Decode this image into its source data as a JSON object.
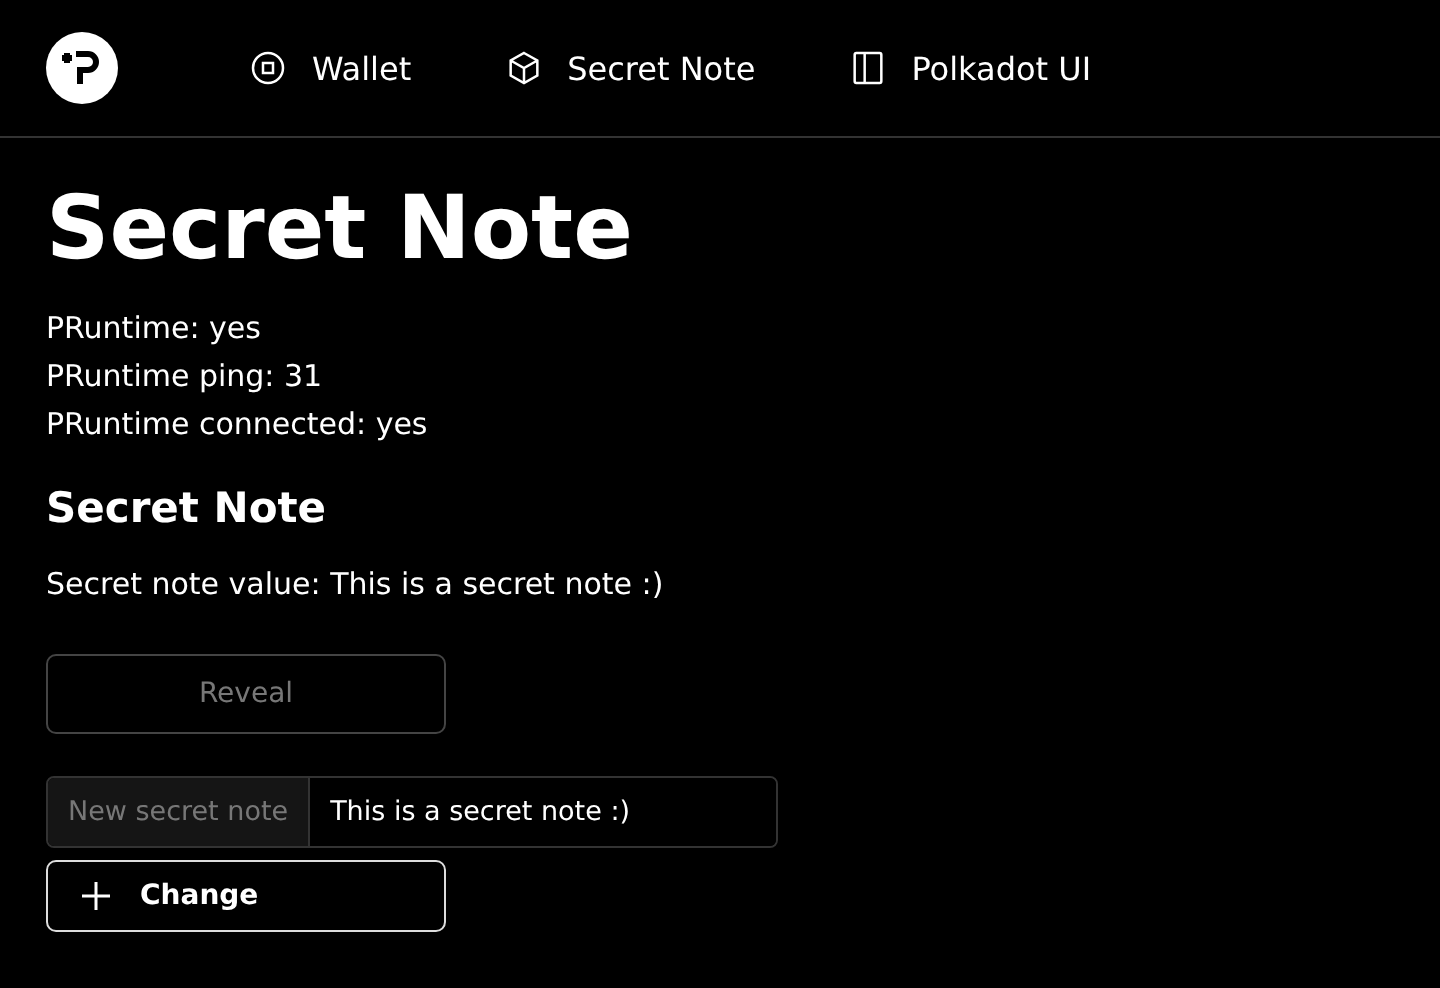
{
  "nav": [
    {
      "label": "Wallet",
      "kind": "wallet"
    },
    {
      "label": "Secret Note",
      "kind": "note"
    },
    {
      "label": "Polkadot UI",
      "kind": "ui"
    }
  ],
  "page": {
    "title": "Secret Note",
    "status": [
      "PRuntime: yes",
      "PRuntime ping: 31",
      "PRuntime connected: yes"
    ]
  },
  "section": {
    "heading": "Secret Note",
    "value_line": "Secret note value: This is a secret note :)",
    "reveal_button": {
      "label": "Reveal",
      "disabled": true
    },
    "input": {
      "addon": "New secret note",
      "value": "This is a secret note :)"
    },
    "change_button": {
      "label": "Change",
      "disabled": false
    }
  }
}
